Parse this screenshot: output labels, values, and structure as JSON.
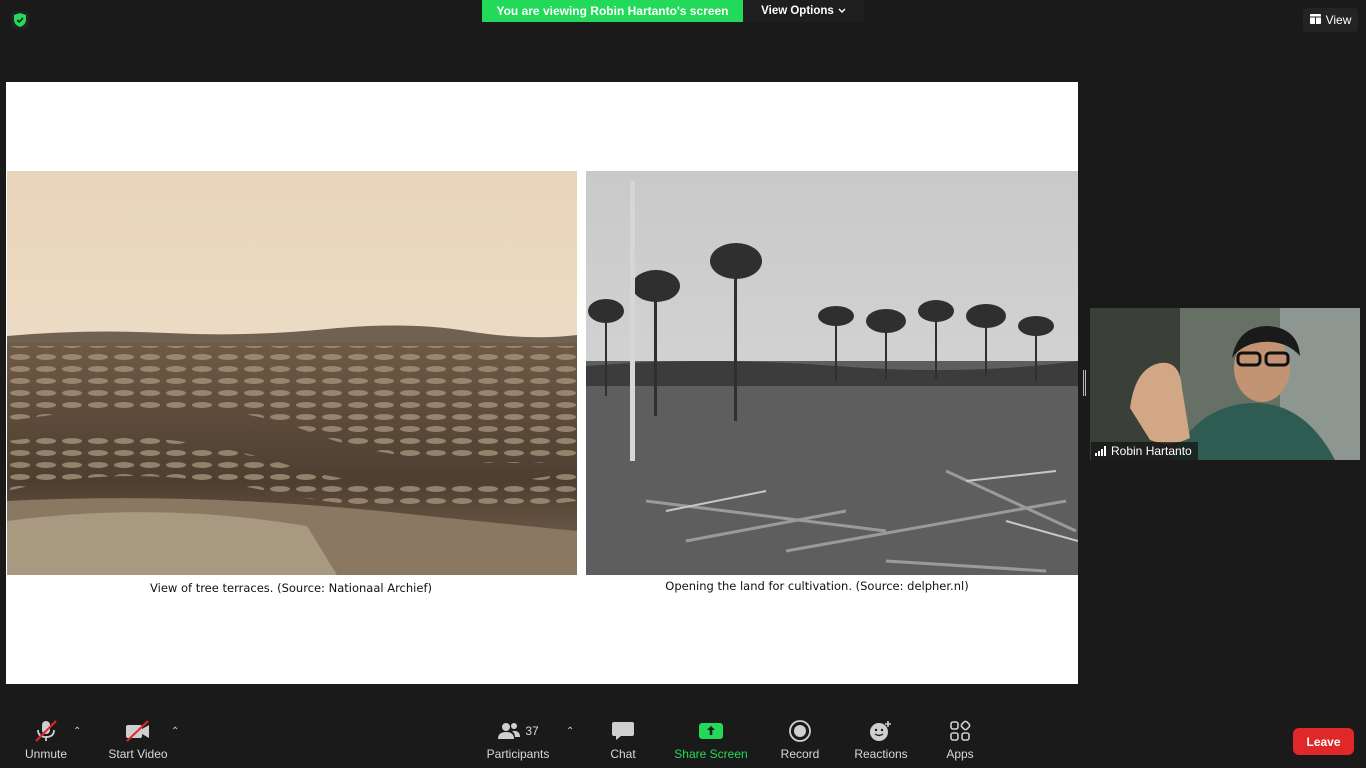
{
  "banner": {
    "viewing_text": "You are viewing Robin Hartanto's screen",
    "view_options_label": "View Options"
  },
  "view_button": {
    "label": "View"
  },
  "slide": {
    "caption_left": "View of tree terraces. (Source: Nationaal Archief)",
    "caption_right": "Opening the land for cultivation. (Source: delpher.nl)"
  },
  "video": {
    "participant_name": "Robin Hartanto"
  },
  "toolbar": {
    "unmute_label": "Unmute",
    "start_video_label": "Start Video",
    "participants_label": "Participants",
    "participants_count": "37",
    "chat_label": "Chat",
    "share_screen_label": "Share Screen",
    "record_label": "Record",
    "reactions_label": "Reactions",
    "apps_label": "Apps",
    "leave_label": "Leave"
  },
  "colors": {
    "accent_green": "#23d959",
    "leave_red": "#e02828",
    "background": "#1a1a1a"
  }
}
